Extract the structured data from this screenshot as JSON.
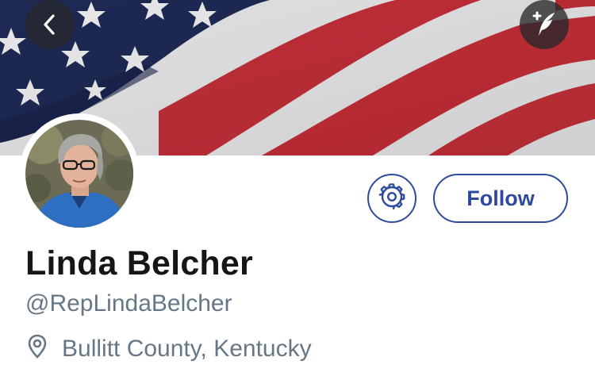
{
  "profile": {
    "name": "Linda Belcher",
    "handle": "@RepLindaBelcher",
    "location": "Bullitt County, Kentucky"
  },
  "actions": {
    "follow_label": "Follow"
  },
  "icons": {
    "back": "chevron-left-icon",
    "compose": "compose-tweet-icon",
    "settings": "gear-icon",
    "location": "location-pin-icon"
  },
  "colors": {
    "accent": "#2e4a9c",
    "name_text": "#14171a",
    "secondary_text": "#657786"
  }
}
